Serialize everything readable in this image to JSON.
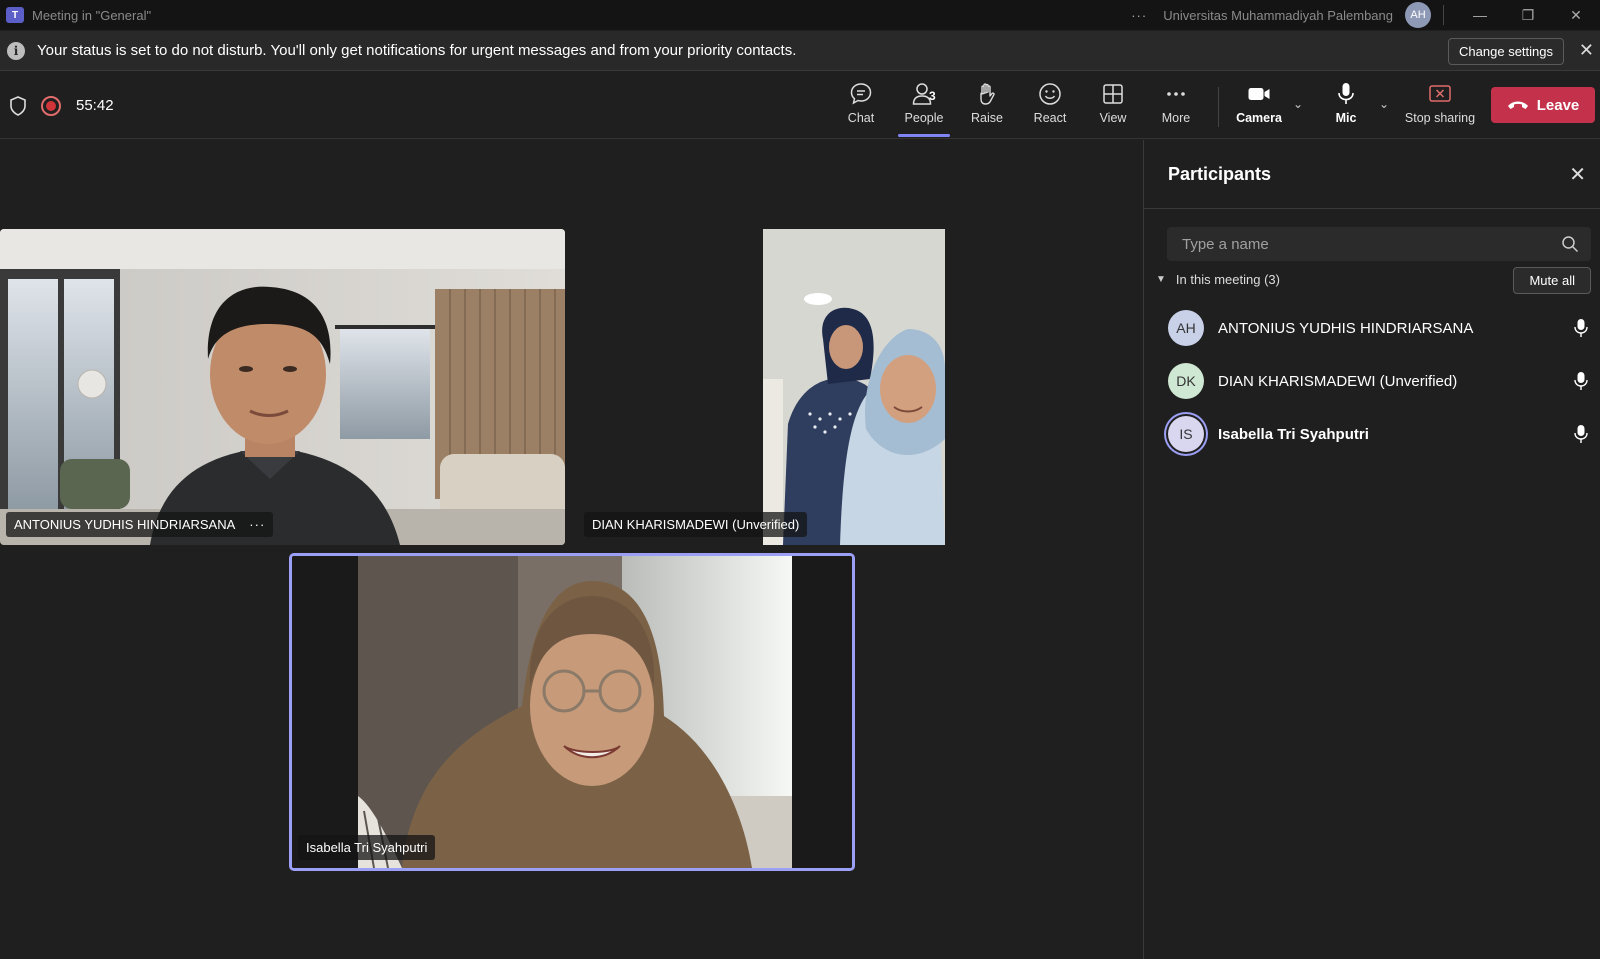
{
  "titlebar": {
    "app_icon": "T",
    "title": "Meeting in \"General\"",
    "more": "···",
    "org": "Universitas Muhammadiyah Palembang",
    "avatar": "AH",
    "minimize": "—",
    "maximize": "❐",
    "close": "✕"
  },
  "banner": {
    "info_icon": "i",
    "message": "Your status is set to do not disturb. You'll only get notifications for urgent messages and from your priority contacts.",
    "change_settings": "Change settings",
    "close": "✕"
  },
  "toolbar": {
    "timer": "55:42",
    "chat": "Chat",
    "people": "People",
    "people_count": "3",
    "raise": "Raise",
    "react": "React",
    "view": "View",
    "more": "More",
    "camera": "Camera",
    "mic": "Mic",
    "stop_sharing": "Stop sharing",
    "leave": "Leave",
    "chevron": "⌄",
    "active_tab": "People",
    "colors": {
      "leave": "#c4314b",
      "accent": "#7f85f5",
      "stop_sharing": "#e06c6c"
    }
  },
  "stage": {
    "tiles": [
      {
        "name": "ANTONIUS YUDHIS HINDRIARSANA",
        "more": "···"
      },
      {
        "name": "DIAN KHARISMADEWI (Unverified)"
      },
      {
        "name": "Isabella Tri Syahputri",
        "speaking": true
      }
    ]
  },
  "participants": {
    "title": "Participants",
    "close": "✕",
    "search_placeholder": "Type a name",
    "section": "In this meeting (3)",
    "section_caret": "▼",
    "mute_all": "Mute all",
    "people": [
      {
        "initials": "AH",
        "name": "ANTONIUS YUDHIS HINDRIARSANA",
        "color": "#c9d1e8"
      },
      {
        "initials": "DK",
        "name": "DIAN KHARISMADEWI (Unverified)",
        "color": "#cfe8d3"
      },
      {
        "initials": "IS",
        "name": "Isabella Tri Syahputri",
        "color": "#d9d6f0"
      }
    ]
  }
}
